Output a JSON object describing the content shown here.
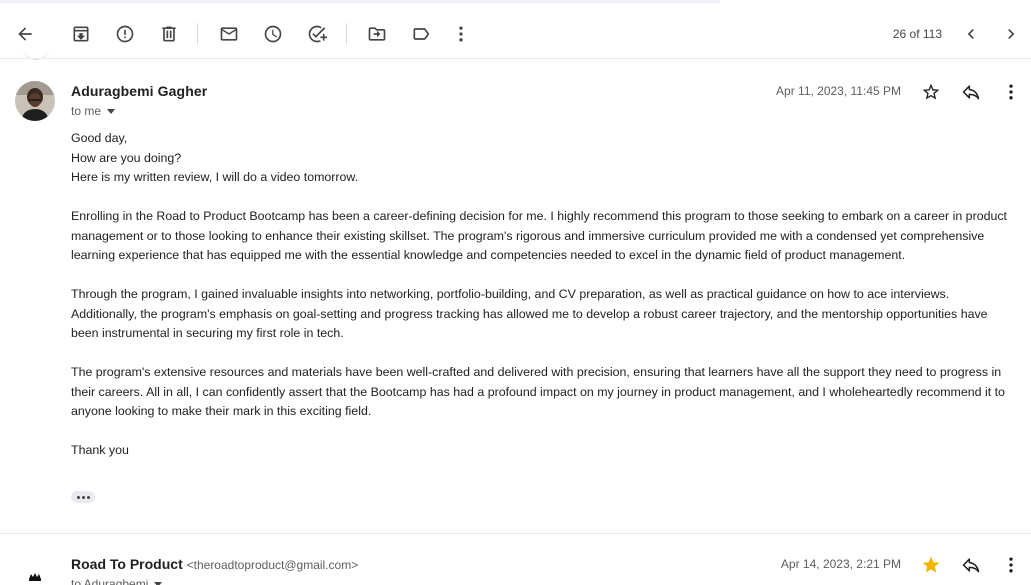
{
  "toolbar": {
    "buttons": [
      {
        "name": "back",
        "icon": "arrow-left-icon"
      },
      {
        "name": "archive",
        "icon": "archive-icon"
      },
      {
        "name": "report-spam",
        "icon": "report-icon"
      },
      {
        "name": "delete",
        "icon": "trash-icon"
      },
      {
        "name": "mark-unread",
        "icon": "mail-icon"
      },
      {
        "name": "snooze",
        "icon": "clock-icon"
      },
      {
        "name": "add-to-tasks",
        "icon": "add-task-icon"
      },
      {
        "name": "move-to",
        "icon": "folder-move-icon"
      },
      {
        "name": "label",
        "icon": "label-icon"
      },
      {
        "name": "more",
        "icon": "more-vert-icon"
      }
    ],
    "pager_text": "26 of 113"
  },
  "message1": {
    "sender_name": "Aduragbemi Gagher",
    "recipient": "to me",
    "date": "Apr 11, 2023, 11:45 PM",
    "starred": false,
    "body": [
      "Good day,",
      "How are you doing?",
      "Here is my written review, I will do a video tomorrow.",
      "",
      "Enrolling in the Road to Product Bootcamp has been a career-defining decision for me. I highly recommend this program to those seeking to embark on a career in product management or to those looking to enhance their existing skillset. The program's rigorous and immersive curriculum provided me with a condensed yet comprehensive learning experience that has equipped me with the essential knowledge and competencies needed to excel in the dynamic field of product management.",
      "",
      "Through the program, I gained invaluable insights into networking, portfolio-building, and CV preparation, as well as practical guidance on how to ace interviews. Additionally, the program's emphasis on goal-setting and progress tracking has allowed me to develop a robust career trajectory, and the mentorship opportunities have been instrumental in securing my first role in tech.",
      "",
      "The program's extensive resources and materials have been well-crafted and delivered with precision, ensuring that learners have all the support they need to progress in their careers. All in all, I can confidently assert that the Bootcamp has had a profound impact on my journey in product management, and I wholeheartedly recommend it to anyone looking to make their mark in this exciting field.",
      "",
      "Thank you"
    ]
  },
  "message2": {
    "sender_name": "Road To Product",
    "sender_email": "<theroadtoproduct@gmail.com>",
    "recipient": "to Aduragbemi",
    "date": "Apr 14, 2023, 2:21 PM",
    "starred": true
  },
  "colors": {
    "star_filled": "#f4b400",
    "icon": "#444746",
    "text_secondary": "#5e5e5e"
  }
}
